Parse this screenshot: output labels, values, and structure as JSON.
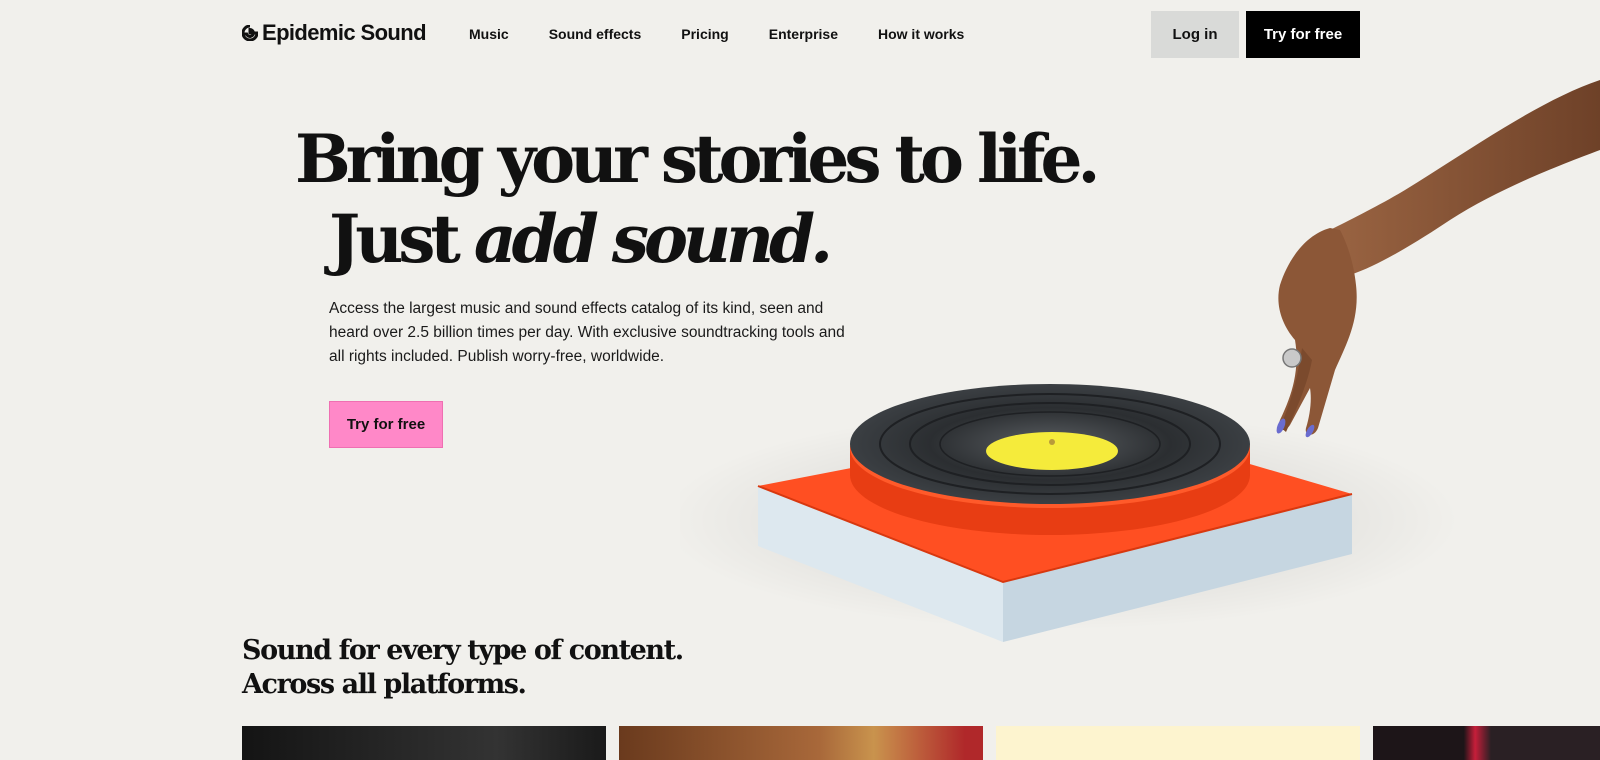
{
  "header": {
    "logo_text": "Epidemic Sound",
    "nav": [
      "Music",
      "Sound effects",
      "Pricing",
      "Enterprise",
      "How it works"
    ],
    "login_label": "Log in",
    "try_label": "Try for free"
  },
  "hero": {
    "line1": "Bring your stories to life.",
    "line2_plain": "Just ",
    "line2_italic": "add sound.",
    "description": "Access the largest music and sound effects catalog of its kind, seen and heard over 2.5 billion times per day. With exclusive soundtracking tools and all rights included. Publish worry-free, worldwide.",
    "cta_label": "Try for free"
  },
  "section": {
    "title_line1": "Sound for every type of content.",
    "title_line2": "Across all platforms."
  },
  "colors": {
    "background": "#f1f0ec",
    "primary_button": "#000000",
    "secondary_button": "#d9dad8",
    "accent_pink": "#ff88c8",
    "turntable_orange": "#ff4f22",
    "record_label_yellow": "#f5eb3b"
  }
}
